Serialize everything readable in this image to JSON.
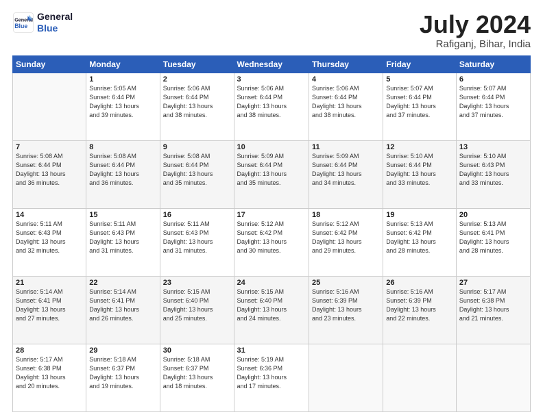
{
  "logo": {
    "line1": "General",
    "line2": "Blue"
  },
  "title": "July 2024",
  "subtitle": "Rafiganj, Bihar, India",
  "header_days": [
    "Sunday",
    "Monday",
    "Tuesday",
    "Wednesday",
    "Thursday",
    "Friday",
    "Saturday"
  ],
  "weeks": [
    [
      {
        "day": "",
        "info": ""
      },
      {
        "day": "1",
        "info": "Sunrise: 5:05 AM\nSunset: 6:44 PM\nDaylight: 13 hours\nand 39 minutes."
      },
      {
        "day": "2",
        "info": "Sunrise: 5:06 AM\nSunset: 6:44 PM\nDaylight: 13 hours\nand 38 minutes."
      },
      {
        "day": "3",
        "info": "Sunrise: 5:06 AM\nSunset: 6:44 PM\nDaylight: 13 hours\nand 38 minutes."
      },
      {
        "day": "4",
        "info": "Sunrise: 5:06 AM\nSunset: 6:44 PM\nDaylight: 13 hours\nand 38 minutes."
      },
      {
        "day": "5",
        "info": "Sunrise: 5:07 AM\nSunset: 6:44 PM\nDaylight: 13 hours\nand 37 minutes."
      },
      {
        "day": "6",
        "info": "Sunrise: 5:07 AM\nSunset: 6:44 PM\nDaylight: 13 hours\nand 37 minutes."
      }
    ],
    [
      {
        "day": "7",
        "info": "Sunrise: 5:08 AM\nSunset: 6:44 PM\nDaylight: 13 hours\nand 36 minutes."
      },
      {
        "day": "8",
        "info": "Sunrise: 5:08 AM\nSunset: 6:44 PM\nDaylight: 13 hours\nand 36 minutes."
      },
      {
        "day": "9",
        "info": "Sunrise: 5:08 AM\nSunset: 6:44 PM\nDaylight: 13 hours\nand 35 minutes."
      },
      {
        "day": "10",
        "info": "Sunrise: 5:09 AM\nSunset: 6:44 PM\nDaylight: 13 hours\nand 35 minutes."
      },
      {
        "day": "11",
        "info": "Sunrise: 5:09 AM\nSunset: 6:44 PM\nDaylight: 13 hours\nand 34 minutes."
      },
      {
        "day": "12",
        "info": "Sunrise: 5:10 AM\nSunset: 6:44 PM\nDaylight: 13 hours\nand 33 minutes."
      },
      {
        "day": "13",
        "info": "Sunrise: 5:10 AM\nSunset: 6:43 PM\nDaylight: 13 hours\nand 33 minutes."
      }
    ],
    [
      {
        "day": "14",
        "info": "Sunrise: 5:11 AM\nSunset: 6:43 PM\nDaylight: 13 hours\nand 32 minutes."
      },
      {
        "day": "15",
        "info": "Sunrise: 5:11 AM\nSunset: 6:43 PM\nDaylight: 13 hours\nand 31 minutes."
      },
      {
        "day": "16",
        "info": "Sunrise: 5:11 AM\nSunset: 6:43 PM\nDaylight: 13 hours\nand 31 minutes."
      },
      {
        "day": "17",
        "info": "Sunrise: 5:12 AM\nSunset: 6:42 PM\nDaylight: 13 hours\nand 30 minutes."
      },
      {
        "day": "18",
        "info": "Sunrise: 5:12 AM\nSunset: 6:42 PM\nDaylight: 13 hours\nand 29 minutes."
      },
      {
        "day": "19",
        "info": "Sunrise: 5:13 AM\nSunset: 6:42 PM\nDaylight: 13 hours\nand 28 minutes."
      },
      {
        "day": "20",
        "info": "Sunrise: 5:13 AM\nSunset: 6:41 PM\nDaylight: 13 hours\nand 28 minutes."
      }
    ],
    [
      {
        "day": "21",
        "info": "Sunrise: 5:14 AM\nSunset: 6:41 PM\nDaylight: 13 hours\nand 27 minutes."
      },
      {
        "day": "22",
        "info": "Sunrise: 5:14 AM\nSunset: 6:41 PM\nDaylight: 13 hours\nand 26 minutes."
      },
      {
        "day": "23",
        "info": "Sunrise: 5:15 AM\nSunset: 6:40 PM\nDaylight: 13 hours\nand 25 minutes."
      },
      {
        "day": "24",
        "info": "Sunrise: 5:15 AM\nSunset: 6:40 PM\nDaylight: 13 hours\nand 24 minutes."
      },
      {
        "day": "25",
        "info": "Sunrise: 5:16 AM\nSunset: 6:39 PM\nDaylight: 13 hours\nand 23 minutes."
      },
      {
        "day": "26",
        "info": "Sunrise: 5:16 AM\nSunset: 6:39 PM\nDaylight: 13 hours\nand 22 minutes."
      },
      {
        "day": "27",
        "info": "Sunrise: 5:17 AM\nSunset: 6:38 PM\nDaylight: 13 hours\nand 21 minutes."
      }
    ],
    [
      {
        "day": "28",
        "info": "Sunrise: 5:17 AM\nSunset: 6:38 PM\nDaylight: 13 hours\nand 20 minutes."
      },
      {
        "day": "29",
        "info": "Sunrise: 5:18 AM\nSunset: 6:37 PM\nDaylight: 13 hours\nand 19 minutes."
      },
      {
        "day": "30",
        "info": "Sunrise: 5:18 AM\nSunset: 6:37 PM\nDaylight: 13 hours\nand 18 minutes."
      },
      {
        "day": "31",
        "info": "Sunrise: 5:19 AM\nSunset: 6:36 PM\nDaylight: 13 hours\nand 17 minutes."
      },
      {
        "day": "",
        "info": ""
      },
      {
        "day": "",
        "info": ""
      },
      {
        "day": "",
        "info": ""
      }
    ]
  ]
}
